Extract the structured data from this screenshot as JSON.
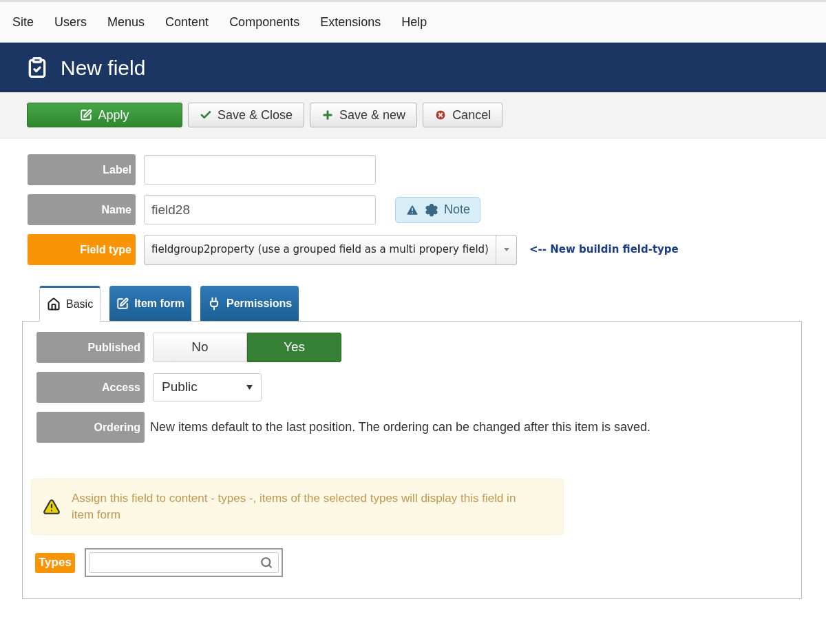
{
  "menu": [
    "Site",
    "Users",
    "Menus",
    "Content",
    "Components",
    "Extensions",
    "Help"
  ],
  "title": "New field",
  "toolbar": [
    {
      "label": "Apply",
      "kind": "primary"
    },
    {
      "label": "Save & Close",
      "kind": "check"
    },
    {
      "label": "Save & new",
      "kind": "plus"
    },
    {
      "label": "Cancel",
      "kind": "cancel"
    }
  ],
  "fields": [
    {
      "label": "Label",
      "highlighted": false,
      "kind": "text"
    },
    {
      "label": "Name",
      "highlighted": false,
      "kind": "text",
      "value": "field28",
      "note": "Note"
    },
    {
      "label": "Field type",
      "highlighted": true,
      "kind": "select",
      "value": "fieldgroup2property (use a grouped field as a multi propery field)",
      "annotation": "<-- New buildin field-type"
    }
  ],
  "tabs": [
    {
      "label": "Basic",
      "selected": true
    },
    {
      "label": "Item form",
      "selected": false
    },
    {
      "label": "Permissions",
      "selected": false
    }
  ],
  "basic": [
    {
      "label": "Published",
      "kind": "toggle",
      "options": [
        {
          "label": "No",
          "selected": false
        },
        {
          "label": "Yes",
          "selected": true
        }
      ]
    },
    {
      "label": "Access",
      "kind": "select",
      "value": "Public"
    },
    {
      "label": "Ordering",
      "kind": "text",
      "value": "New items default to the last position. The ordering can be changed after this item is saved."
    }
  ],
  "alert": "Assign this field to content - types -, items of the selected types will display this field in item form",
  "types": {
    "label": "Types"
  }
}
